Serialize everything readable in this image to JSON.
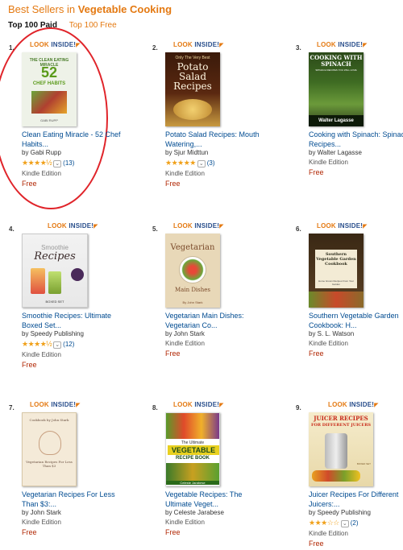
{
  "header": {
    "prefix": "Best Sellers in",
    "category": "Vegetable Cooking"
  },
  "tabs": {
    "paid": "Top 100 Paid",
    "free": "Top 100 Free"
  },
  "colors": {
    "brand_orange": "#e47911",
    "link_blue": "#004b91",
    "price_red": "#b12704",
    "star_gold": "#f0a019",
    "highlight_circle": "#e0242a"
  },
  "look_inside": {
    "word1": "LOOK",
    "word2": "INSIDE!"
  },
  "items": [
    {
      "rank": "1.",
      "title": "Clean Eating Miracle - 52 Chef Habits...",
      "author": "by Gabi Rupp",
      "stars": "★★★★½",
      "rating": 4.5,
      "reviews": "(13)",
      "format": "Kindle Edition",
      "price": "Free",
      "cover": {
        "line1": "THE CLEAN EATING MIRACLE",
        "line2": "52",
        "line3": "CHEF HABITS",
        "author": "GABI RUPP"
      }
    },
    {
      "rank": "2.",
      "title": "Potato Salad Recipes: Mouth Watering,...",
      "author": "by Sjur Midttun",
      "stars": "★★★★★",
      "rating": 5,
      "reviews": "(3)",
      "format": "Kindle Edition",
      "price": "Free",
      "cover": {
        "line1": "Only The Very Best",
        "line2": "Potato Salad Recipes"
      }
    },
    {
      "rank": "3.",
      "title": "Cooking with Spinach: Spinach Recipes...",
      "author": "by Walter Lagasse",
      "format": "Kindle Edition",
      "price": "Free",
      "cover": {
        "line1": "COOKING WITH SPINACH",
        "line2": "SPINACH RECIPES YOU WILL LOVE",
        "author": "Walter Lagasse"
      }
    },
    {
      "rank": "4.",
      "title": "Smoothie Recipes: Ultimate Boxed Set...",
      "author": "by Speedy Publishing",
      "stars": "★★★★½",
      "rating": 4.5,
      "reviews": "(12)",
      "format": "Kindle Edition",
      "price": "Free",
      "cover": {
        "line1": "Smoothie",
        "line2": "Recipes",
        "line3": "BOXED SET"
      }
    },
    {
      "rank": "5.",
      "title": "Vegetarian Main Dishes: Vegetarian Co...",
      "author": "by John Stark",
      "format": "Kindle Edition",
      "price": "Free",
      "cover": {
        "line1": "Vegetarian",
        "line2": "Main Dishes",
        "author": "By John Stark"
      }
    },
    {
      "rank": "6.",
      "title": "Southern Vegetable Garden Cookbook: H...",
      "author": "by S. L. Watson",
      "format": "Kindle Edition",
      "price": "Free",
      "cover": {
        "line1": "Southern Vegetable Garden Cookbook",
        "line2": "Home Grown Recipes From Your Garden"
      }
    },
    {
      "rank": "7.",
      "title": "Vegetarian Recipes For Less Than $3:...",
      "author": "by John Stark",
      "format": "Kindle Edition",
      "price": "Free",
      "cover": {
        "line1": "Cookbook by John Stark",
        "line2": "Vegetarian Recipes For Less Than $3"
      }
    },
    {
      "rank": "8.",
      "title": "Vegetable Recipes: The Ultimate Veget...",
      "author": "by Celeste Jarabese",
      "format": "Kindle Edition",
      "price": "Free",
      "cover": {
        "line1": "The Ultimate",
        "line2": "VEGETABLE",
        "line3": "RECIPE BOOK",
        "author": "Celeste Jarabese"
      }
    },
    {
      "rank": "9.",
      "title": "Juicer Recipes For Different Juicers:...",
      "author": "by Speedy Publishing",
      "stars": "★★★☆☆",
      "rating": 3,
      "reviews": "(2)",
      "format": "Kindle Edition",
      "price": "Free",
      "cover": {
        "line1": "JUICER RECIPES",
        "line2": "FOR DIFFERENT JUICERS",
        "line3": "BOXED SET"
      }
    }
  ]
}
